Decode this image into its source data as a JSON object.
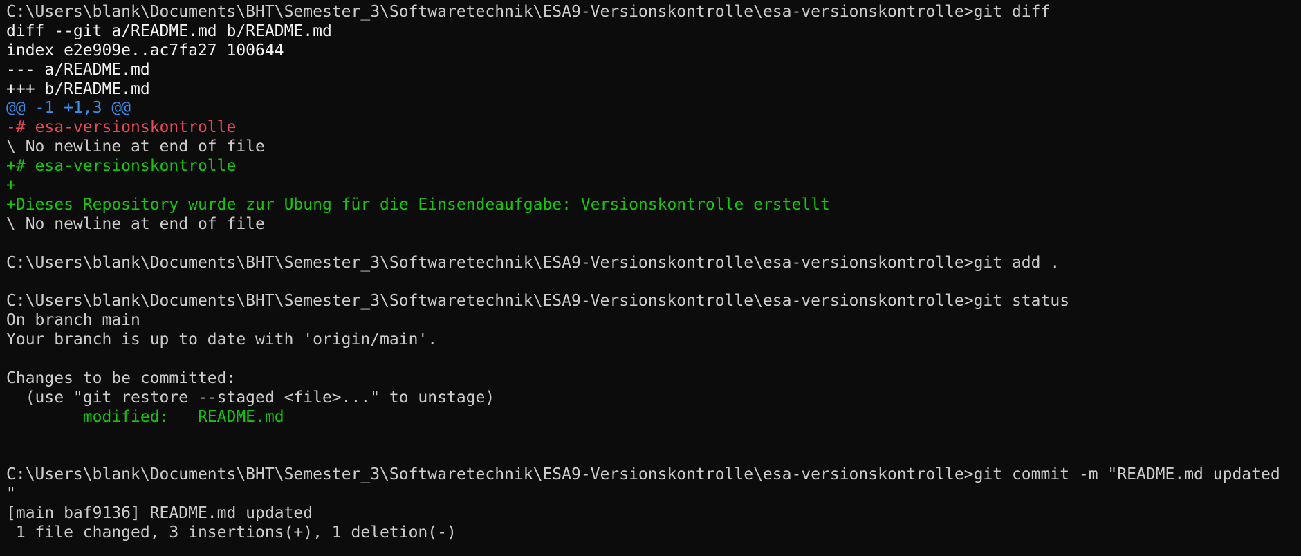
{
  "theme": {
    "background": "#0c0c0c",
    "foreground": "#cccccc",
    "header": "#f2f2f2",
    "hunk": "#3b8eea",
    "removed": "#e74856",
    "added": "#16c60c"
  },
  "lines": [
    {
      "text": "C:\\Users\\blank\\Documents\\BHT\\Semester_3\\Softwaretechnik\\ESA9-Versionskontrolle\\esa-versionskontrolle>git diff",
      "kind": "prompt"
    },
    {
      "text": "diff --git a/README.md b/README.md",
      "kind": "header"
    },
    {
      "text": "index e2e909e..ac7fa27 100644",
      "kind": "header"
    },
    {
      "text": "--- a/README.md",
      "kind": "header"
    },
    {
      "text": "+++ b/README.md",
      "kind": "header"
    },
    {
      "text": "@@ -1 +1,3 @@",
      "kind": "hunk"
    },
    {
      "text": "-# esa-versionskontrolle",
      "kind": "removed"
    },
    {
      "text": "\\ No newline at end of file",
      "kind": "plain"
    },
    {
      "text": "+# esa-versionskontrolle",
      "kind": "added"
    },
    {
      "text": "+",
      "kind": "added"
    },
    {
      "text": "+Dieses Repository wurde zur Übung für die Einsendeaufgabe: Versionskontrolle erstellt",
      "kind": "added"
    },
    {
      "text": "\\ No newline at end of file",
      "kind": "plain"
    },
    {
      "text": "",
      "kind": "plain"
    },
    {
      "text": "C:\\Users\\blank\\Documents\\BHT\\Semester_3\\Softwaretechnik\\ESA9-Versionskontrolle\\esa-versionskontrolle>git add .",
      "kind": "prompt"
    },
    {
      "text": "",
      "kind": "plain"
    },
    {
      "text": "C:\\Users\\blank\\Documents\\BHT\\Semester_3\\Softwaretechnik\\ESA9-Versionskontrolle\\esa-versionskontrolle>git status",
      "kind": "prompt"
    },
    {
      "text": "On branch main",
      "kind": "plain"
    },
    {
      "text": "Your branch is up to date with 'origin/main'.",
      "kind": "plain"
    },
    {
      "text": "",
      "kind": "plain"
    },
    {
      "text": "Changes to be committed:",
      "kind": "plain"
    },
    {
      "text": "  (use \"git restore --staged <file>...\" to unstage)",
      "kind": "plain"
    },
    {
      "text": "        modified:   README.md",
      "kind": "added"
    },
    {
      "text": "",
      "kind": "plain"
    },
    {
      "text": "",
      "kind": "plain"
    },
    {
      "text": "C:\\Users\\blank\\Documents\\BHT\\Semester_3\\Softwaretechnik\\ESA9-Versionskontrolle\\esa-versionskontrolle>git commit -m \"README.md updated",
      "kind": "prompt"
    },
    {
      "text": "\"",
      "kind": "plain"
    },
    {
      "text": "[main baf9136] README.md updated",
      "kind": "plain"
    },
    {
      "text": " 1 file changed, 3 insertions(+), 1 deletion(-)",
      "kind": "plain"
    }
  ]
}
